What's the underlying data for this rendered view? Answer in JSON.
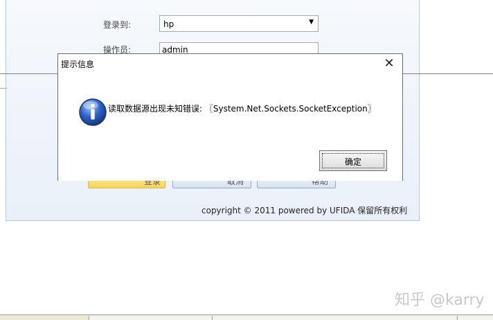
{
  "login_window": {
    "login_to_label": "登录到:",
    "server_value": "hp",
    "operator_label": "操作员:",
    "operator_value": "admin",
    "login_button": "登录",
    "cancel_button": "取消",
    "help_button": "帮助",
    "copyright": "copyright © 2011 powered by UFIDA 保留所有权利"
  },
  "dialog": {
    "title": "提示信息",
    "close_glyph": "✕",
    "message": "读取数据源出现未知错误: 〖System.Net.Sockets.SocketException〗",
    "ok_button": "确定"
  },
  "watermark": "知乎 @karry",
  "colors": {
    "accent_icon": "#1f4fa8",
    "login_button": "#f6d45c"
  },
  "icons": {
    "dialog_icon": "info-icon"
  }
}
